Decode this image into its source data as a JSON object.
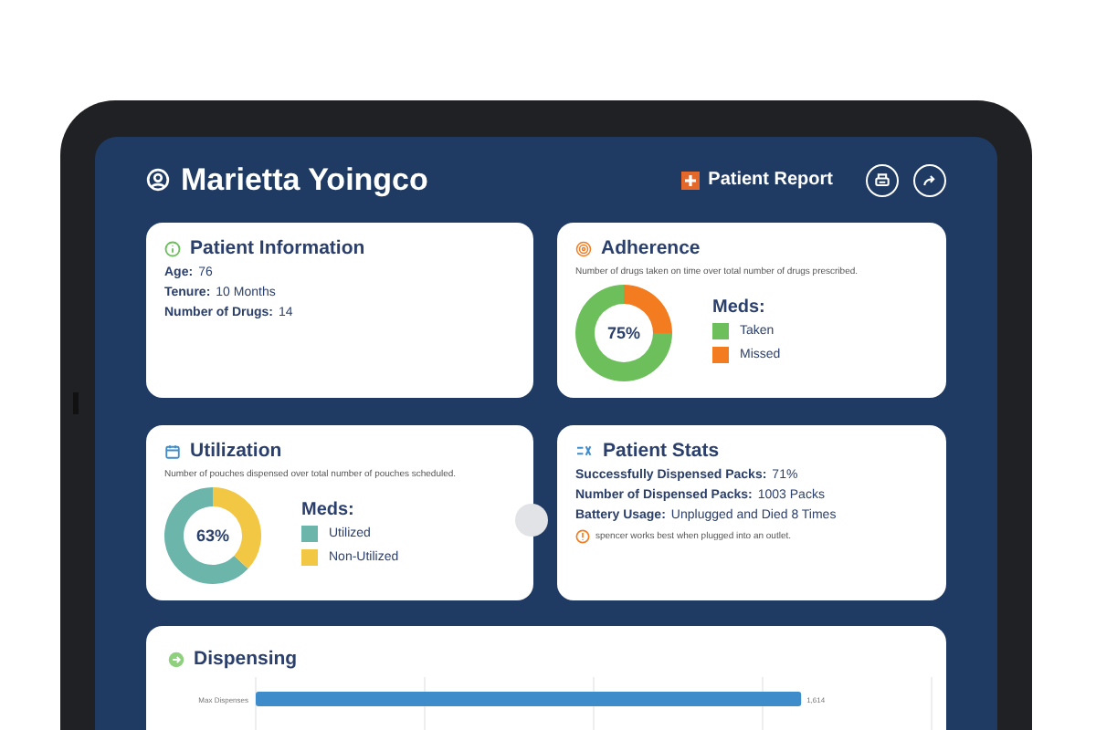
{
  "header": {
    "patient_name": "Marietta Yoingco",
    "report_button": "Patient Report"
  },
  "patient_information": {
    "title": "Patient Information",
    "fields": [
      {
        "label": "Age:",
        "value": "76"
      },
      {
        "label": "Tenure:",
        "value": "10 Months"
      },
      {
        "label": "Number of Drugs:",
        "value": "14"
      }
    ]
  },
  "adherence": {
    "title": "Adherence",
    "description": "Number of drugs taken on time over total number of drugs prescribed.",
    "chart_data": {
      "type": "donut",
      "categories": [
        "Taken",
        "Missed"
      ],
      "values": [
        75,
        25
      ]
    },
    "center_label": "75%",
    "legend_title": "Meds:",
    "legend": [
      {
        "color": "#6cbf5a"
      },
      {
        "color": "#f47c20"
      }
    ]
  },
  "utilization": {
    "title": "Utilization",
    "description": "Number of pouches dispensed over total number of pouches scheduled.",
    "chart_data": {
      "type": "donut",
      "categories": [
        "Utilized",
        "Non-Utilized"
      ],
      "values": [
        63,
        37
      ]
    },
    "center_label": "63%",
    "legend_title": "Meds:",
    "legend": [
      {
        "color": "#6bb5ab"
      },
      {
        "color": "#f2c744"
      }
    ]
  },
  "patient_stats": {
    "title": "Patient Stats",
    "fields": [
      {
        "label": "Successfully Dispensed Packs:",
        "value": "71%"
      },
      {
        "label": "Number of Dispensed Packs:",
        "value": "1003 Packs"
      },
      {
        "label": "Battery Usage:",
        "value": "Unplugged and Died 8 Times"
      }
    ],
    "warning": "spencer works best when plugged into an outlet."
  },
  "dispensing": {
    "title": "Dispensing",
    "chart_data": {
      "type": "bar",
      "orientation": "horizontal",
      "categories": [
        "Max Dispenses"
      ],
      "values": [
        1614
      ],
      "value_labels": [
        "1,614"
      ]
    }
  }
}
